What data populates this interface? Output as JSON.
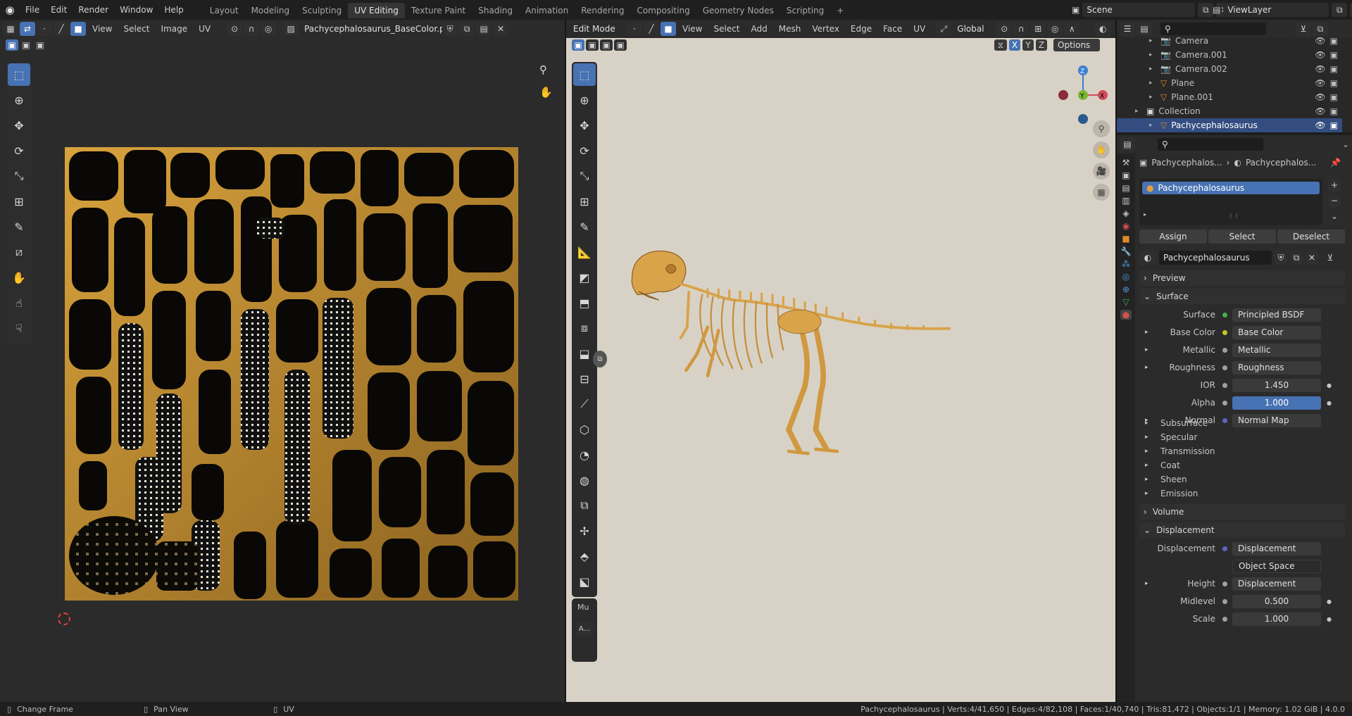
{
  "topbar": {
    "menus": [
      "File",
      "Edit",
      "Render",
      "Window",
      "Help"
    ],
    "workspaces": [
      "Layout",
      "Modeling",
      "Sculpting",
      "UV Editing",
      "Texture Paint",
      "Shading",
      "Animation",
      "Rendering",
      "Compositing",
      "Geometry Nodes",
      "Scripting"
    ],
    "active_workspace": "UV Editing",
    "add_tab": "+",
    "scene": "Scene",
    "view_layer": "ViewLayer"
  },
  "uv_editor": {
    "menus": [
      "View",
      "Select",
      "Image",
      "UV"
    ],
    "image_name": "Pachycephalosaurus_BaseColor.png"
  },
  "viewport": {
    "mode": "Edit Mode",
    "menus": [
      "View",
      "Select",
      "Add",
      "Mesh",
      "Vertex",
      "Edge",
      "Face",
      "UV"
    ],
    "orientation": "Global",
    "options": "Options",
    "axes": [
      "X",
      "Y",
      "Z"
    ],
    "gizmo": {
      "z": "Z",
      "y": "Y",
      "x": "X"
    },
    "panel_label": "Mu",
    "panel_button": "A..."
  },
  "outliner": {
    "rows": [
      {
        "name": "Camera",
        "type": "camera"
      },
      {
        "name": "Camera.001",
        "type": "camera"
      },
      {
        "name": "Camera.002",
        "type": "camera"
      },
      {
        "name": "Plane",
        "type": "mesh"
      },
      {
        "name": "Plane.001",
        "type": "mesh"
      },
      {
        "name": "Collection",
        "type": "collection"
      },
      {
        "name": "Pachycephalosaurus",
        "type": "mesh",
        "selected": true
      }
    ]
  },
  "properties": {
    "breadcrumb": [
      "Pachycephalos...",
      "Pachycephalos..."
    ],
    "slot": "Pachycephalosaurus",
    "slot_buttons": [
      "Assign",
      "Select",
      "Deselect"
    ],
    "material_name": "Pachycephalosaurus",
    "sections": {
      "preview": "Preview",
      "surface": "Surface",
      "volume": "Volume",
      "displacement": "Displacement"
    },
    "surface_rows": [
      {
        "label": "Surface",
        "value": "Principled BSDF",
        "dot": "#3fb04b"
      },
      {
        "label": "Base Color",
        "value": "Base Color",
        "dot": "#c7c729"
      },
      {
        "label": "Metallic",
        "value": "Metallic",
        "dot": "#a1a1a1"
      },
      {
        "label": "Roughness",
        "value": "Roughness",
        "dot": "#a1a1a1"
      },
      {
        "label": "IOR",
        "value": "1.450",
        "dot": "#a1a1a1"
      },
      {
        "label": "Alpha",
        "value": "1.000",
        "dot": "#a1a1a1"
      },
      {
        "label": "Normal",
        "value": "Normal Map",
        "dot": "#6363c7"
      }
    ],
    "subpanels": [
      "Subsurface",
      "Specular",
      "Transmission",
      "Coat",
      "Sheen",
      "Emission"
    ],
    "displacement_rows": [
      {
        "label": "Displacement",
        "value": "Displacement",
        "dot": "#6363c7"
      },
      {
        "label": "",
        "value": "Object Space",
        "dot": ""
      },
      {
        "label": "Height",
        "value": "Displacement",
        "dot": "#a1a1a1"
      },
      {
        "label": "Midlevel",
        "value": "0.500",
        "dot": "#a1a1a1"
      },
      {
        "label": "Scale",
        "value": "1.000",
        "dot": "#a1a1a1"
      }
    ]
  },
  "statusbar": {
    "hints": [
      "Change Frame",
      "Pan View",
      "UV"
    ],
    "stats": "Pachycephalosaurus | Verts:4/41,650 | Edges:4/82,108 | Faces:1/40,740 | Tris:81,472 | Objects:1/1 | Memory: 1.02 GiB | 4.0.0"
  },
  "colors": {
    "accent": "#4772b3",
    "viewport_bg": "#d8d2c6",
    "uv_bg": "#2b2b2b",
    "texture_gold": "#c48e2c",
    "skeleton": "#d9a34a"
  }
}
